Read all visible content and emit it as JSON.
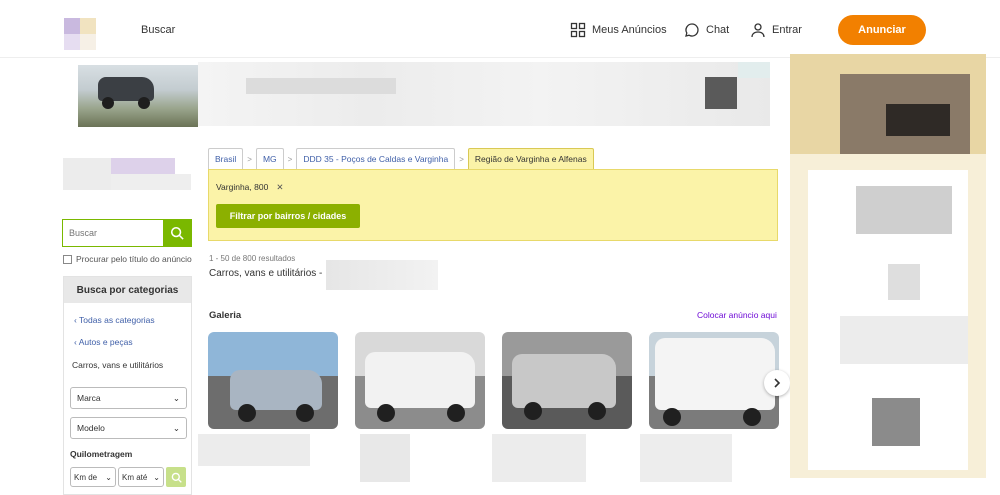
{
  "header": {
    "search_label": "Buscar",
    "my_ads_label": "Meus Anúncios",
    "chat_label": "Chat",
    "login_label": "Entrar",
    "post_button": "Anunciar",
    "accent_color": "#f28000"
  },
  "sidebar": {
    "search_placeholder": "Buscar",
    "title_only_label": "Procurar pelo título do anúncio",
    "categories_header": "Busca por categorias",
    "all_categories": "Todas as categorias",
    "parent_category": "Autos e peças",
    "current_category": "Carros, vans e utilitários",
    "brand_select": "Marca",
    "model_select": "Modelo",
    "mileage_label": "Quilometragem",
    "km_from": "Km de",
    "km_to": "Km até"
  },
  "breadcrumbs": [
    {
      "label": "Brasil"
    },
    {
      "label": "MG"
    },
    {
      "label": "DDD 35 - Poços de Caldas e Varginha"
    },
    {
      "label": "Região de Varginha e Alfenas"
    }
  ],
  "filter": {
    "tag_city": "Varginha",
    "tag_count": "800",
    "filter_button": "Filtrar por bairros / cidades"
  },
  "results": {
    "count_text": "1 - 50 de 800 resultados",
    "title": "Carros, vans e utilitários -"
  },
  "gallery": {
    "title": "Galeria",
    "post_link": "Colocar anúncio aqui",
    "cards": [
      {
        "name": "silver-sedan",
        "sky": "#8fb6d8",
        "ground": "#6d6d6d",
        "body": "#a9b5c2"
      },
      {
        "name": "white-pickup",
        "sky": "#d9d9d9",
        "ground": "#8c8c8c",
        "body": "#f2f2f2"
      },
      {
        "name": "silver-suv",
        "sky": "#9a9a9a",
        "ground": "#5a5a5a",
        "body": "#c8c8c8"
      },
      {
        "name": "white-van",
        "sky": "#c7d3db",
        "ground": "#7b7b7b",
        "body": "#f4f4f4"
      }
    ]
  }
}
